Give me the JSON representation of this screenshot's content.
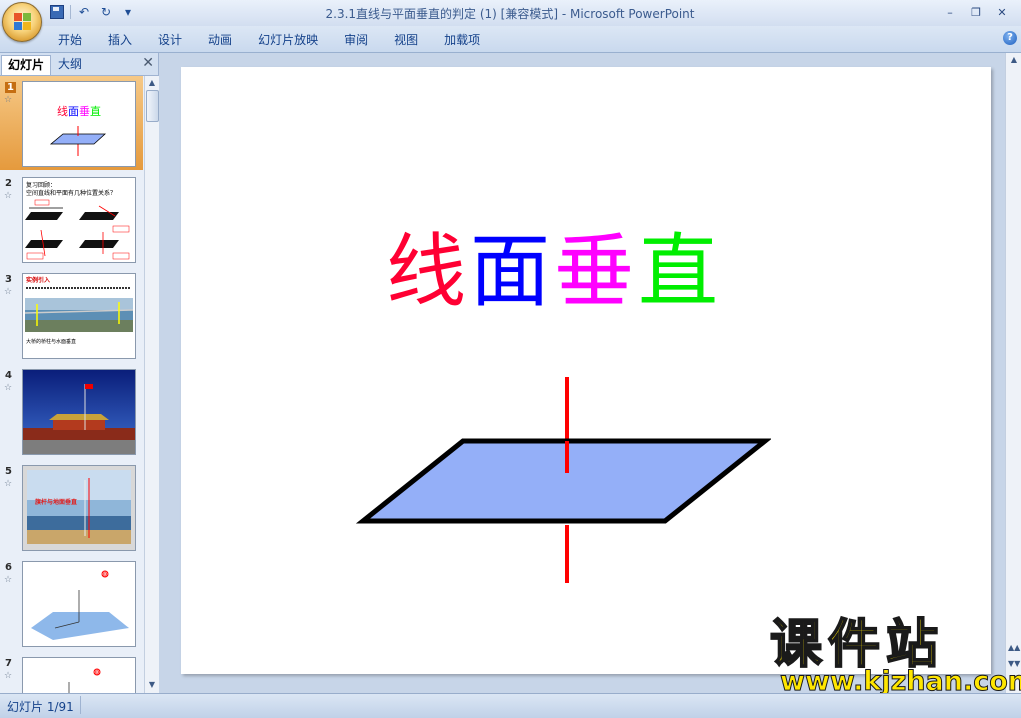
{
  "window": {
    "title": "2.3.1直线与平面垂直的判定 (1) [兼容模式] - Microsoft PowerPoint"
  },
  "quick_access": {
    "save_icon": "save-icon",
    "undo_glyph": "↶",
    "redo_glyph": "↻",
    "customize_glyph": "▾"
  },
  "window_controls": {
    "minimize": "–",
    "restore": "❐",
    "close": "✕"
  },
  "ribbon": {
    "tabs": [
      "开始",
      "插入",
      "设计",
      "动画",
      "幻灯片放映",
      "审阅",
      "视图",
      "加载项"
    ],
    "help": "?"
  },
  "panel": {
    "tab_slides": "幻灯片",
    "tab_outline": "大纲",
    "close": "✕"
  },
  "thumbnails": [
    {
      "number": "1",
      "star": "☆",
      "title": "线面垂直"
    },
    {
      "number": "2",
      "star": "☆",
      "line1": "复习回顾：",
      "line2": "空间直线和平面有几种位置关系？"
    },
    {
      "number": "3",
      "star": "☆",
      "heading": "实例引入",
      "caption": "大桥的桥柱与水面垂直"
    },
    {
      "number": "4",
      "star": "☆"
    },
    {
      "number": "5",
      "star": "☆",
      "caption": "旗杆与地面垂直"
    },
    {
      "number": "6",
      "star": "☆"
    },
    {
      "number": "7",
      "star": "☆"
    }
  ],
  "slide": {
    "title_chars": [
      "线",
      "面",
      "垂",
      "直"
    ],
    "title_colors": [
      "#ff0033",
      "#0000ff",
      "#ff00ff",
      "#00ee00"
    ]
  },
  "colors": {
    "plane_fill": "#94aff8",
    "line_red": "#ff0000",
    "selected_thumb": "#f0b060"
  },
  "watermark": {
    "cn": "课件站",
    "url": "www.kjzhan.com"
  },
  "status": {
    "slide_counter": "幻灯片 1/91"
  }
}
